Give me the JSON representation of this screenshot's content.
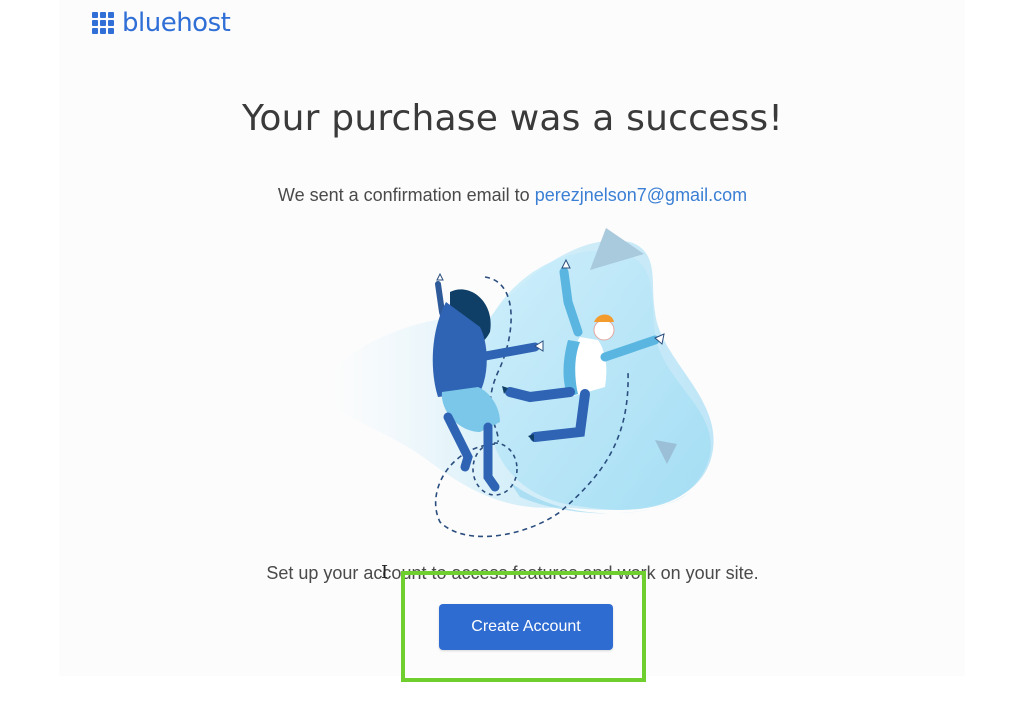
{
  "brand": {
    "name": "bluehost",
    "color": "#2f6fd6"
  },
  "main": {
    "headline": "Your purchase was a success!",
    "confirmation_prefix": "We sent a confirmation email to",
    "email": "perezjnelson7@gmail.com",
    "setup_text": "Set up your account to access features and work on your site.",
    "create_account_label": "Create Account"
  },
  "colors": {
    "button": "#2e6cd1",
    "highlight": "#6fcf2e",
    "link": "#3b7fd4"
  },
  "icons": {
    "logo": "grid-icon",
    "illustration": "celebration-illustration",
    "cursor": "text-cursor-icon"
  }
}
